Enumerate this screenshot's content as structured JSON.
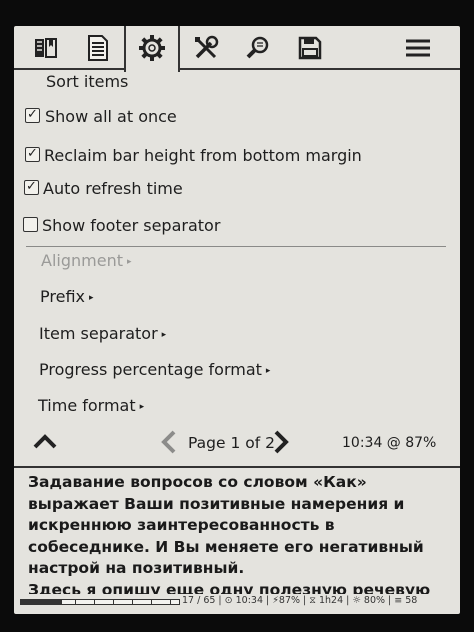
{
  "toolbar": {
    "icons": [
      "bookmark-list-icon",
      "document-icon",
      "gear-icon",
      "tools-icon",
      "search-icon",
      "save-icon",
      "hamburger-menu-icon"
    ],
    "active": "gear-icon"
  },
  "menu": {
    "header": "Sort items",
    "checkboxes": [
      {
        "label": "Show all at once",
        "checked": true,
        "mark": "✓"
      },
      {
        "label": "Reclaim bar height from bottom margin",
        "checked": true,
        "mark": "✓"
      },
      {
        "label": "Auto refresh time",
        "checked": true,
        "mark": "✓"
      },
      {
        "label": "Show footer separator",
        "checked": false,
        "mark": ""
      }
    ],
    "submenus": [
      {
        "label": "Alignment",
        "disabled": true
      },
      {
        "label": "Prefix",
        "disabled": false
      },
      {
        "label": "Item separator",
        "disabled": false
      },
      {
        "label": "Progress percentage format",
        "disabled": false
      },
      {
        "label": "Time format",
        "disabled": false
      }
    ],
    "arrow": "▸"
  },
  "pagination": {
    "label": "Page 1 of 2",
    "clock_battery": "10:34 @ 87%"
  },
  "book": {
    "text": "Задавание вопросов со словом «Как»\nвыражает Ваши позитивные намерения и\nискреннюю заинтересованность в\nсобеседнике. И Вы меняете его негативный\nнастрой на позитивный.\nЗдесь я опишу еще одну полезную речевую"
  },
  "status_bar": {
    "progress_fraction": 0.26,
    "text": "17 / 65 | ⊙ 10:34 | ⚡87% | ⧖ 1h24 | ☼ 80% | ≡ 58"
  },
  "colors": {
    "screen": "#e4e3de",
    "ink": "#1e1e1e",
    "disabled": "#9a9a98"
  }
}
